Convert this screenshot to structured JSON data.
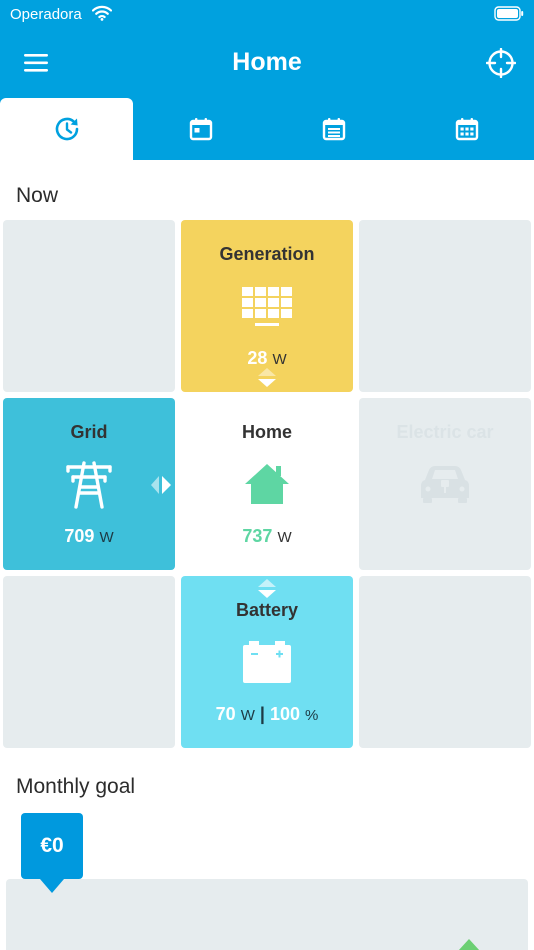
{
  "status_bar": {
    "carrier": "Operadora"
  },
  "header": {
    "title": "Home"
  },
  "tabs": [
    {
      "icon": "clock-icon",
      "active": true
    },
    {
      "icon": "calendar-day-icon",
      "active": false
    },
    {
      "icon": "calendar-list-icon",
      "active": false
    },
    {
      "icon": "calendar-grid-icon",
      "active": false
    }
  ],
  "now": {
    "title": "Now",
    "generation": {
      "label": "Generation",
      "value": "28",
      "unit": "W"
    },
    "grid": {
      "label": "Grid",
      "value": "709",
      "unit": "W"
    },
    "home": {
      "label": "Home",
      "value": "737",
      "unit": "W"
    },
    "electric_car": {
      "label": "Electric car"
    },
    "battery": {
      "label": "Battery",
      "power": "70",
      "power_unit": "W",
      "separator": "|",
      "charge": "100",
      "charge_unit": "%"
    }
  },
  "monthly_goal": {
    "title": "Monthly goal",
    "amount": "€0"
  },
  "colors": {
    "brand": "#00a1df",
    "generation": "#f4d35e",
    "grid": "#3ec0da",
    "battery": "#6fdff2",
    "home_accent": "#5ed6a3",
    "tile_empty": "#e6ecee",
    "goal_badge": "#0099de",
    "goal_marker": "#6ccf73"
  }
}
